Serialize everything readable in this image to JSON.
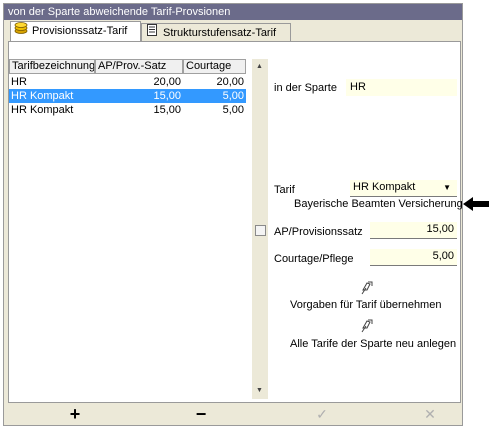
{
  "window": {
    "title": "von der Sparte abweichende Tarif-Provsionen"
  },
  "tabs": [
    {
      "label": "Provisionssatz-Tarif",
      "icon": "coins-icon",
      "active": true
    },
    {
      "label": "Strukturstufensatz-Tarif",
      "icon": "list-icon",
      "active": false
    }
  ],
  "table": {
    "columns": [
      "Tarifbezeichnung",
      "AP/Prov.-Satz",
      "Courtage"
    ],
    "rows": [
      {
        "name": "HR",
        "ap": "20,00",
        "courtage": "20,00",
        "selected": false
      },
      {
        "name": "HR Kompakt",
        "ap": "15,00",
        "courtage": "5,00",
        "selected": true
      },
      {
        "name": "HR Kompakt",
        "ap": "15,00",
        "courtage": "5,00",
        "selected": false
      }
    ]
  },
  "detail": {
    "sparte_label": "in der Sparte",
    "sparte_value": "HR",
    "tarif_label": "Tarif",
    "tarif_value": "HR Kompakt",
    "tarif_desc": "Bayerische Beamten Versicherung",
    "ap_label": "AP/Provisionssatz",
    "ap_value": "15,00",
    "courtage_label": "Courtage/Pflege",
    "courtage_value": "5,00",
    "action1": "Vorgaben für Tarif übernehmen",
    "action2": "Alle Tarife der Sparte neu anlegen"
  },
  "bottom": {
    "add": "+",
    "remove": "−",
    "confirm": "✓",
    "cancel": "✕"
  },
  "colors": {
    "title_bg": "#6b6b8a",
    "selection": "#3399ff",
    "field_bg": "#ffffe8"
  }
}
